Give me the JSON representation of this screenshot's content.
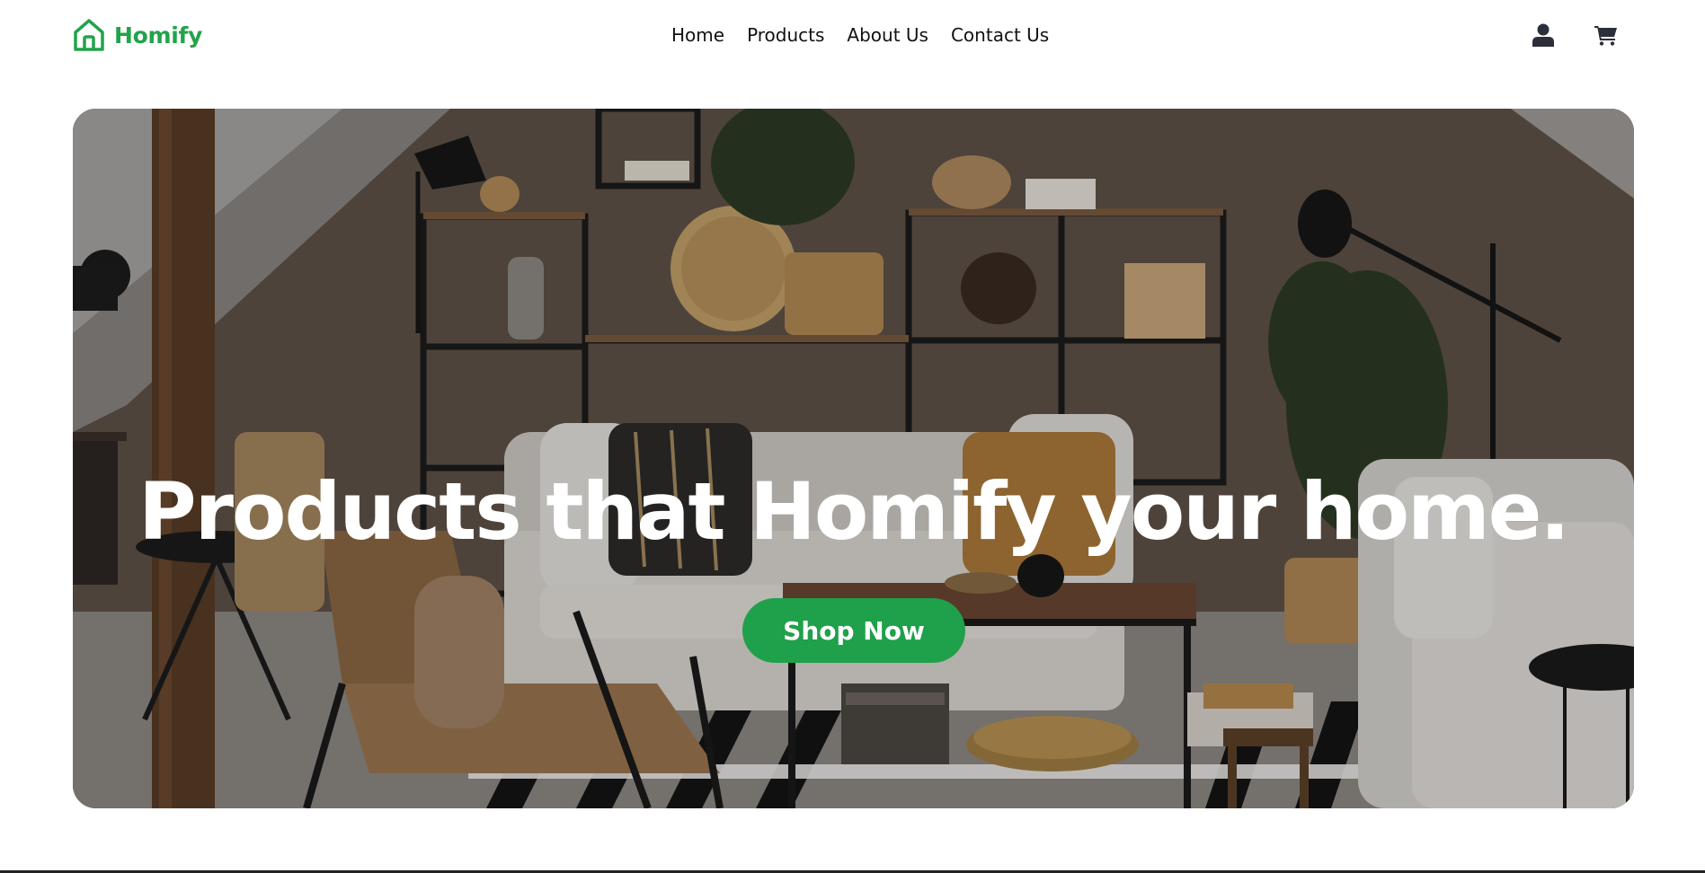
{
  "brand": {
    "name": "Homify",
    "color": "#22a34a"
  },
  "nav": {
    "items": [
      {
        "label": "Home"
      },
      {
        "label": "Products"
      },
      {
        "label": "About Us"
      },
      {
        "label": "Contact Us"
      }
    ]
  },
  "header_icons": {
    "account": "user-icon",
    "cart": "cart-icon"
  },
  "hero": {
    "title": "Products that Homify your home.",
    "cta_label": "Shop Now",
    "cta_color": "#1fa04a",
    "image": "living-room-photo"
  }
}
